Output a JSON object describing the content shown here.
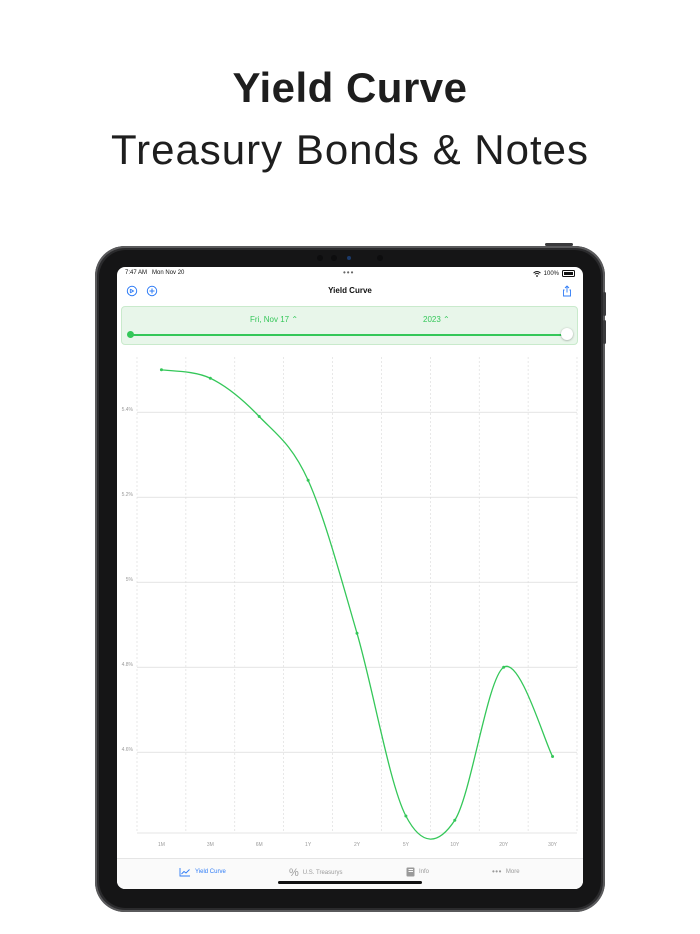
{
  "headline": {
    "title": "Yield Curve",
    "subtitle": "Treasury Bonds & Notes"
  },
  "status_bar": {
    "time": "7:47 AM",
    "date": "Mon Nov 20",
    "battery": "100%"
  },
  "nav": {
    "title": "Yield Curve",
    "left_icons": [
      "history-icon",
      "add-icon"
    ],
    "right_icon": "share-icon"
  },
  "date_picker": {
    "date_value": "Fri, Nov 17 ⌃",
    "year_value": "2023 ⌃",
    "slider_position": 1.0
  },
  "colors": {
    "accent": "#34c759",
    "tab_active": "#2f7cf6",
    "panel_bg": "#e8f6ea"
  },
  "chart_data": {
    "type": "line",
    "categories": [
      "1M",
      "3M",
      "6M",
      "1Y",
      "2Y",
      "5Y",
      "10Y",
      "20Y",
      "30Y"
    ],
    "values": [
      5.5,
      5.48,
      5.39,
      5.24,
      4.88,
      4.45,
      4.44,
      4.8,
      4.59
    ],
    "y_ticks": [
      {
        "value": 5.4,
        "label": "5.4%"
      },
      {
        "value": 5.2,
        "label": "5.2%"
      },
      {
        "value": 5.0,
        "label": "5%"
      },
      {
        "value": 4.8,
        "label": "4.8%"
      },
      {
        "value": 4.6,
        "label": "4.6%"
      }
    ],
    "ylim": [
      4.41,
      5.53
    ],
    "grid": true,
    "title": "",
    "xlabel": "",
    "ylabel": ""
  },
  "tabs": [
    {
      "label": "Yield Curve",
      "icon": "chart-line-icon",
      "active": true
    },
    {
      "label": "U.S. Treasurys",
      "icon": "percent-icon",
      "active": false
    },
    {
      "label": "Info",
      "icon": "book-icon",
      "active": false
    },
    {
      "label": "More",
      "icon": "more-dots-icon",
      "active": false
    }
  ]
}
